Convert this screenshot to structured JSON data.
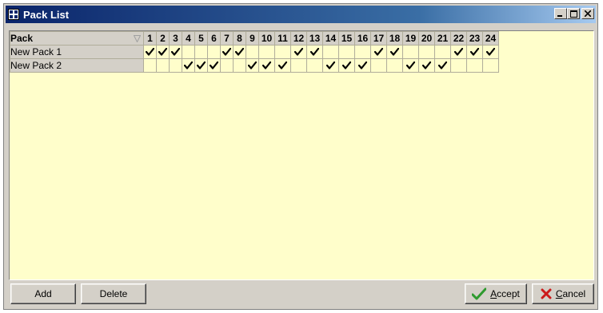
{
  "window": {
    "title": "Pack List"
  },
  "grid": {
    "header": {
      "pack": "Pack",
      "columns": [
        "1",
        "2",
        "3",
        "4",
        "5",
        "6",
        "7",
        "8",
        "9",
        "10",
        "11",
        "12",
        "13",
        "14",
        "15",
        "16",
        "17",
        "18",
        "19",
        "20",
        "21",
        "22",
        "23",
        "24"
      ]
    },
    "rows": [
      {
        "name": "New Pack 1",
        "checks": [
          1,
          1,
          1,
          0,
          0,
          0,
          1,
          1,
          0,
          0,
          0,
          1,
          1,
          0,
          0,
          0,
          1,
          1,
          0,
          0,
          0,
          1,
          1,
          1
        ]
      },
      {
        "name": "New Pack 2",
        "checks": [
          0,
          0,
          0,
          1,
          1,
          1,
          0,
          0,
          1,
          1,
          1,
          0,
          0,
          1,
          1,
          1,
          0,
          0,
          1,
          1,
          1,
          0,
          0,
          0
        ]
      }
    ]
  },
  "buttons": {
    "add": "Add",
    "delete": "Delete",
    "accept": "Accept",
    "cancel": "Cancel"
  },
  "colors": {
    "grid_bg": "#fffecb",
    "accept_icon": "#2e9a2e",
    "cancel_icon": "#cc1a1a"
  }
}
